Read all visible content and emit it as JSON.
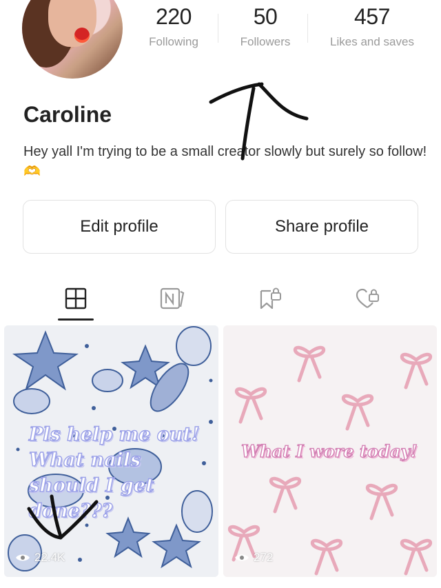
{
  "profile": {
    "name": "Caroline",
    "bio": "Hey yall I'm trying to be a small creator slowly but surely so follow! 🫶"
  },
  "stats": [
    {
      "value": "220",
      "label": "Following"
    },
    {
      "value": "50",
      "label": "Followers"
    },
    {
      "value": "457",
      "label": "Likes and saves"
    }
  ],
  "buttons": {
    "edit": "Edit profile",
    "share": "Share profile"
  },
  "tabs": [
    {
      "icon": "posts-grid-icon",
      "active": true
    },
    {
      "icon": "notes-icon",
      "active": false
    },
    {
      "icon": "saved-lock-icon",
      "active": false
    },
    {
      "icon": "liked-lock-icon",
      "active": false
    }
  ],
  "posts": [
    {
      "text": "Pls help me out! What nails should I get done???",
      "views": "22.4K",
      "bg": "seashells"
    },
    {
      "text": "What I wore today!",
      "views": "272",
      "bg": "pink-bows"
    }
  ],
  "colors": {
    "accent": "#222222",
    "muted": "#9a9a9a",
    "border": "#e2e2e2",
    "shells": "#3f5f9a",
    "bows": "#e8a9ba"
  }
}
